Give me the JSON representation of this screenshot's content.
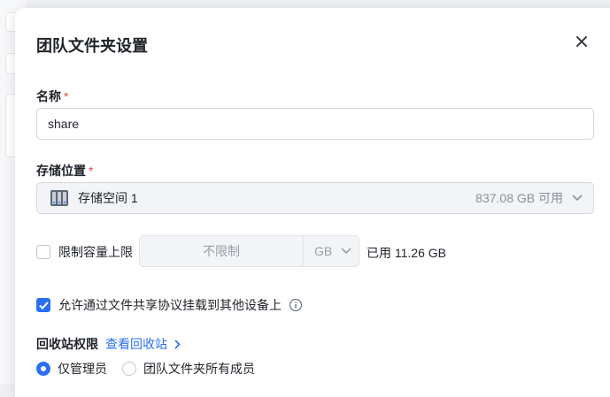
{
  "dialog": {
    "title": "团队文件夹设置"
  },
  "name_field": {
    "label": "名称",
    "required_mark": "*",
    "value": "share"
  },
  "storage_field": {
    "label": "存储位置",
    "required_mark": "*",
    "selected_volume": "存储空间 1",
    "free_space": "837.08 GB 可用"
  },
  "quota": {
    "checkbox_label": "限制容量上限",
    "checked": false,
    "input_placeholder": "不限制",
    "unit": "GB",
    "used_text": "已用 11.26 GB"
  },
  "protocol_mount": {
    "checkbox_label": "允许通过文件共享协议挂载到其他设备上",
    "checked": true
  },
  "recycle_bin": {
    "label": "回收站权限",
    "link_text": "查看回收站",
    "options": [
      {
        "label": "仅管理员",
        "selected": true
      },
      {
        "label": "团队文件夹所有成员",
        "selected": false
      }
    ]
  },
  "colors": {
    "accent": "#2a6ff0",
    "required": "#e5484d"
  }
}
